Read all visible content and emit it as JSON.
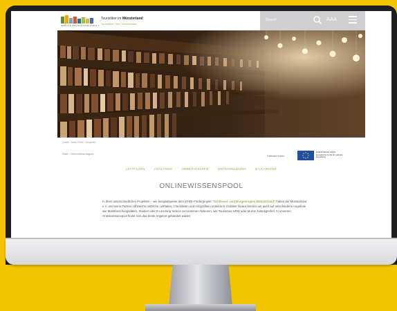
{
  "site": {
    "logo_subtext": "WEBSITE DER MUNSTERLAND E.V.",
    "title_prefix": "Touristiker im",
    "title_bold": "Münsterland",
    "claim": "Touristiker. Hier. Gemeinsam."
  },
  "header": {
    "search_label": "Search",
    "font_size_label": "AAA"
  },
  "hero": {
    "caption": "Quelle: Janko Ferlič / Unsplash",
    "breadcrumb": "Start  ›  Onlinewissenspool"
  },
  "funding": {
    "label": "Gefördert durch:",
    "eu_text": "EUROPÄISCHE UNION Europäischer Fonds für regionale Entwicklung"
  },
  "nav": {
    "items": [
      "LEITFÄDEN",
      "ANALYSEN",
      "ARBEITSHILFEN",
      "WEITERBILDUNG",
      "E-LEARNING"
    ]
  },
  "page": {
    "title": "ONLINEWISSENSPOOL",
    "intro_a": "In ihren unterschiedlichen Projekten – wie beispielsweise dem EFRE-Förderprojekt ",
    "intro_highlight": "\"Schlösser- und Burgenregion Münsterland\"",
    "intro_b": " haben der Münsterland e.V. und seine Partner zahlreiche nützliche Leitfäden, Checklisten und Infografiken entwickelt. Darüber hinaus können wir auch auf verschiedene Angebote wie Marktforschungsdaten, Studien oder E-Learning-Videos von externen Akteuren, wie Tourismus NRW oder tw.nrw zurückgreifen. In unserem Onlinewissenspool findet sich das breite Angebot gebündelt wieder."
  },
  "colors": {
    "accent": "#8fb94a",
    "background": "#f5c400",
    "eu_blue": "#1f4fa8"
  }
}
